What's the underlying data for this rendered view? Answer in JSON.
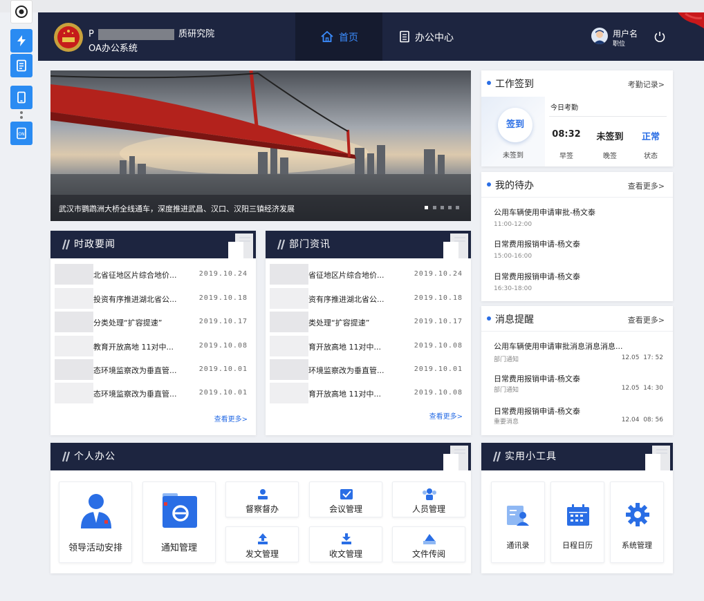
{
  "header": {
    "org_name_visible_prefix": "Ρ",
    "org_name_visible_suffix": "质研究院",
    "system_name": "OA办公系统",
    "nav": [
      {
        "label": "首页",
        "active": true,
        "icon": "home-icon"
      },
      {
        "label": "办公中心",
        "active": false,
        "icon": "document-icon"
      }
    ],
    "user_name": "用户名",
    "user_role": "职位"
  },
  "banner": {
    "caption": "武汉市鹦鹉洲大桥全线通车，深度推进武昌、汉口、汉阳三镇经济发展",
    "slide_count": 5,
    "active_slide": 1
  },
  "attendance": {
    "title": "工作签到",
    "link": "考勤记录>",
    "button": "签到",
    "button_status": "未签到",
    "today_label": "今日考勤",
    "values": [
      "08:32",
      "未签到",
      "正常"
    ],
    "labels": [
      "早签",
      "晚签",
      "状态"
    ]
  },
  "todo": {
    "title": "我的待办",
    "link": "查看更多>",
    "items": [
      {
        "title": "公用车辆使用申请审批-杨文泰",
        "time": "11:00-12:00"
      },
      {
        "title": "日常费用报销申请-杨文泰",
        "time": "15:00-16:00"
      },
      {
        "title": "日常费用报销申请-杨文泰",
        "time": "16:30-18:00"
      }
    ]
  },
  "messages": {
    "title": "消息提醒",
    "link": "查看更多>",
    "items": [
      {
        "title": "公用车辆使用申请审批消息消息消息...",
        "type": "部门通知",
        "time": "12.05  17: 52"
      },
      {
        "title": "日常费用报销申请-杨文泰",
        "type": "部门通知",
        "time": "12.05  14: 30"
      },
      {
        "title": "日常费用报销申请-杨文泰",
        "type": "重要消息",
        "time": "12.04  08: 56"
      }
    ]
  },
  "news": {
    "title": "时政要闻",
    "more": "查看更多>",
    "items": [
      {
        "title": "北省征地区片综合地价...",
        "date": "2019.10.24"
      },
      {
        "title": "投资有序推进湖北省公...",
        "date": "2019.10.18"
      },
      {
        "title": "分类处理“扩容提速”",
        "date": "2019.10.17"
      },
      {
        "title": "教育开放高地 11对中...",
        "date": "2019.10.08"
      },
      {
        "title": "态环境监察改为垂直管...",
        "date": "2019.10.01"
      },
      {
        "title": "态环境监察改为垂直管...",
        "date": "2019.10.01"
      }
    ]
  },
  "dept": {
    "title": "部门资讯",
    "more": "查看更多>",
    "items": [
      {
        "title": "省征地区片综合地价...",
        "date": "2019.10.24"
      },
      {
        "title": "资有序推进湖北省公...",
        "date": "2019.10.18"
      },
      {
        "title": "类处理“扩容提速”",
        "date": "2019.10.17"
      },
      {
        "title": "育开放高地 11对中...",
        "date": "2019.10.08"
      },
      {
        "title": "环境监察改为垂直管...",
        "date": "2019.10.01"
      },
      {
        "title": "育开放高地 11对中...",
        "date": "2019.10.08"
      }
    ]
  },
  "personal": {
    "title": "个人办公",
    "big_tiles": [
      {
        "label": "领导活动安排",
        "icon": "leader-icon"
      },
      {
        "label": "通知管理",
        "icon": "notice-icon"
      }
    ],
    "small_tiles": [
      {
        "label": "督察督办",
        "icon": "supervise-icon"
      },
      {
        "label": "会议管理",
        "icon": "meeting-icon"
      },
      {
        "label": "人员管理",
        "icon": "people-icon"
      },
      {
        "label": "发文管理",
        "icon": "send-doc-icon"
      },
      {
        "label": "收文管理",
        "icon": "receive-doc-icon"
      },
      {
        "label": "文件传阅",
        "icon": "file-circulate-icon"
      }
    ]
  },
  "tools": {
    "title": "实用小工具",
    "items": [
      {
        "label": "通讯录",
        "icon": "contacts-icon"
      },
      {
        "label": "日程日历",
        "icon": "calendar-icon"
      },
      {
        "label": "系统管理",
        "icon": "gear-icon"
      }
    ]
  },
  "colors": {
    "navy": "#1d2540",
    "accent": "#2a6ee5",
    "status_ok": "#2a6ee5"
  }
}
